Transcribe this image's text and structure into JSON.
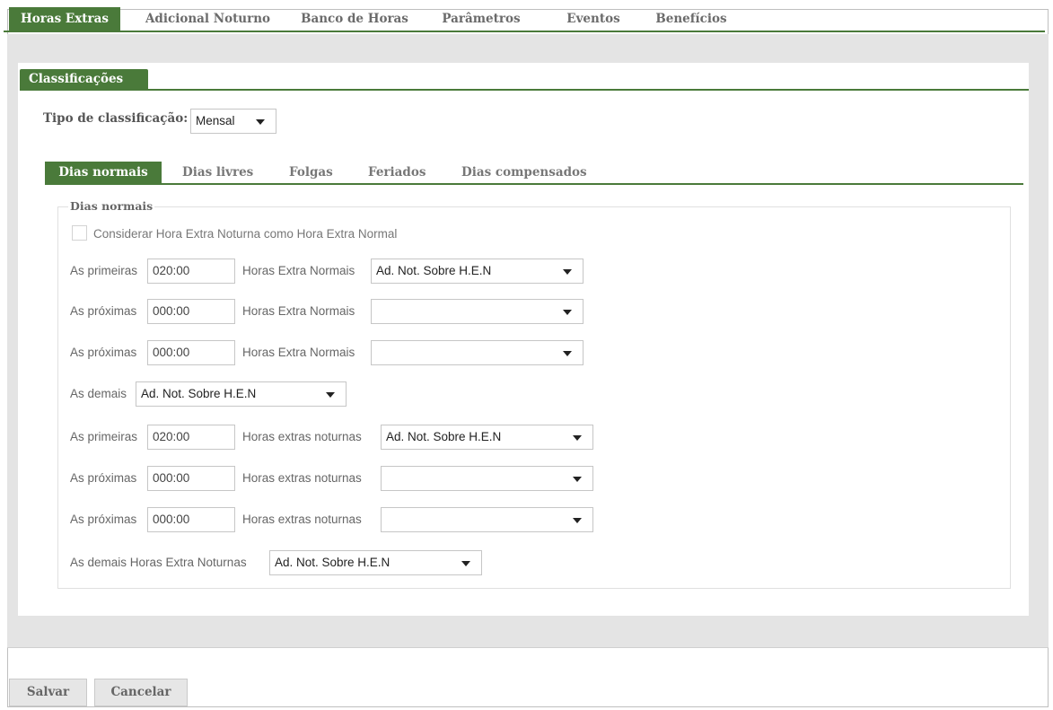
{
  "top_tabs": [
    "Horas Extras",
    "Adicional Noturno",
    "Banco de Horas",
    "Parâmetros",
    "Eventos",
    "Benefícios"
  ],
  "classificacoes_tab": "Classificações",
  "tipo": {
    "label": "Tipo de classificação:",
    "value": "Mensal"
  },
  "sub_tabs": [
    "Dias normais",
    "Dias livres",
    "Folgas",
    "Feriados",
    "Dias compensados"
  ],
  "section": {
    "legend": "Dias normais",
    "checkbox_label": "Considerar Hora Extra Noturna como Hora Extra Normal",
    "checkbox_checked": false
  },
  "rows": [
    {
      "label": "As primeiras",
      "time": "020:00",
      "type_label": "Horas Extra Normais",
      "select": "Ad. Not. Sobre H.E.N"
    },
    {
      "label": "As próximas",
      "time": "000:00",
      "type_label": "Horas Extra Normais",
      "select": ""
    },
    {
      "label": "As próximas",
      "time": "000:00",
      "type_label": "Horas Extra Normais",
      "select": ""
    },
    {
      "label": "As demais",
      "select": "Ad. Not. Sobre H.E.N"
    },
    {
      "label": "As primeiras",
      "time": "020:00",
      "type_label": "Horas extras noturnas",
      "select": "Ad. Not. Sobre H.E.N"
    },
    {
      "label": "As próximas",
      "time": "000:00",
      "type_label": "Horas extras noturnas",
      "select": ""
    },
    {
      "label": "As próximas",
      "time": "000:00",
      "type_label": "Horas extras noturnas",
      "select": ""
    },
    {
      "label": "As demais Horas Extra Noturnas",
      "select": "Ad. Not. Sobre H.E.N"
    }
  ],
  "buttons": {
    "save": "Salvar",
    "cancel": "Cancelar"
  },
  "colors": {
    "accent": "#4a7a3a",
    "panel_bg": "#e4e4e4"
  },
  "icons": {
    "dropdown": "chevron-down-icon"
  }
}
